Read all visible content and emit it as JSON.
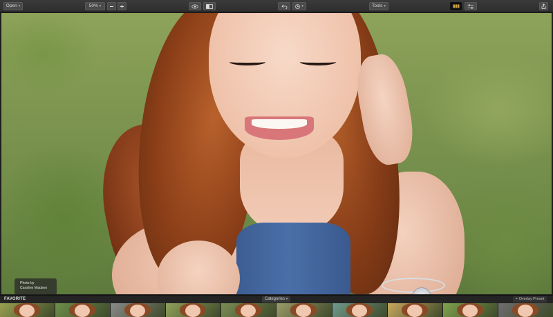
{
  "toolbar": {
    "open_label": "Open",
    "zoom_value": "50%",
    "tools_label": "Tools"
  },
  "photo": {
    "credit_line1": "Photo by",
    "credit_line2": "Caroline Madsen"
  },
  "preset_strip": {
    "section_label": "FAVORITE",
    "categories_label": "Categories",
    "overlay_label": "+ Overlay Preset",
    "thumb_tints": [
      "#9aa050",
      "#6d8f4a",
      "#8a8a8a",
      "#8fa15a",
      "#7a8c55",
      "#9c9c68",
      "#6f9a8c",
      "#c9a85e",
      "#7fa34e",
      "#6e6e6e"
    ]
  },
  "colors": {
    "toolbar_bg": "#2e2e2e",
    "active_button": "#111111",
    "strip_bg": "#242424"
  }
}
